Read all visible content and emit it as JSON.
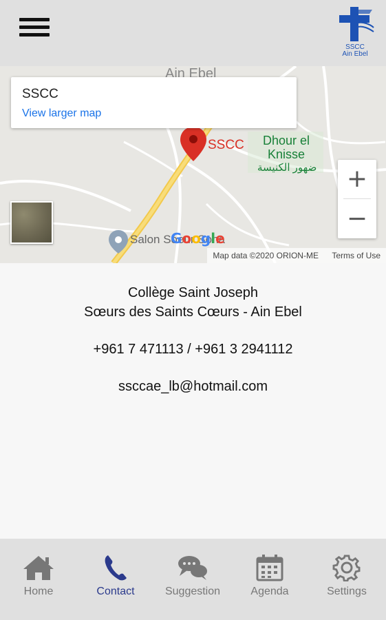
{
  "header": {
    "menu_icon": "hamburger-menu-icon",
    "logo_line1": "SSCC",
    "logo_line2": "Ain Ebel"
  },
  "map": {
    "card_title": "SSCC",
    "card_link": "View larger map",
    "marker_label": "SSCC",
    "place_1": "Dhour el",
    "place_2": "Knisse",
    "place_3": "ضهور الكنيسة",
    "town": "Ain Ebel",
    "poi": "Salon Soeur Soha",
    "google": [
      "G",
      "o",
      "o",
      "g",
      "l",
      "e"
    ],
    "attribution": "Map data ©2020 ORION-ME",
    "terms": "Terms of Use",
    "zoom_in": "+",
    "zoom_out": "−"
  },
  "contact": {
    "name_line1": "Collège Saint Joseph",
    "name_line2": "Sœurs des Saints Cœurs - Ain Ebel",
    "phones": "+961 7 471113 / +961 3 2941112",
    "email": "ssccae_lb@hotmail.com"
  },
  "tabs": [
    {
      "label": "Home",
      "icon": "home-icon",
      "active": false
    },
    {
      "label": "Contact",
      "icon": "phone-icon",
      "active": true
    },
    {
      "label": "Suggestion",
      "icon": "chat-bubbles-icon",
      "active": false
    },
    {
      "label": "Agenda",
      "icon": "calendar-icon",
      "active": false
    },
    {
      "label": "Settings",
      "icon": "gear-icon",
      "active": false
    }
  ],
  "colors": {
    "bar_bg": "#e0e0e0",
    "active_tab": "#2b3a8c",
    "inactive_tab": "#777777",
    "marker": "#d93025",
    "link": "#1a73e8"
  }
}
